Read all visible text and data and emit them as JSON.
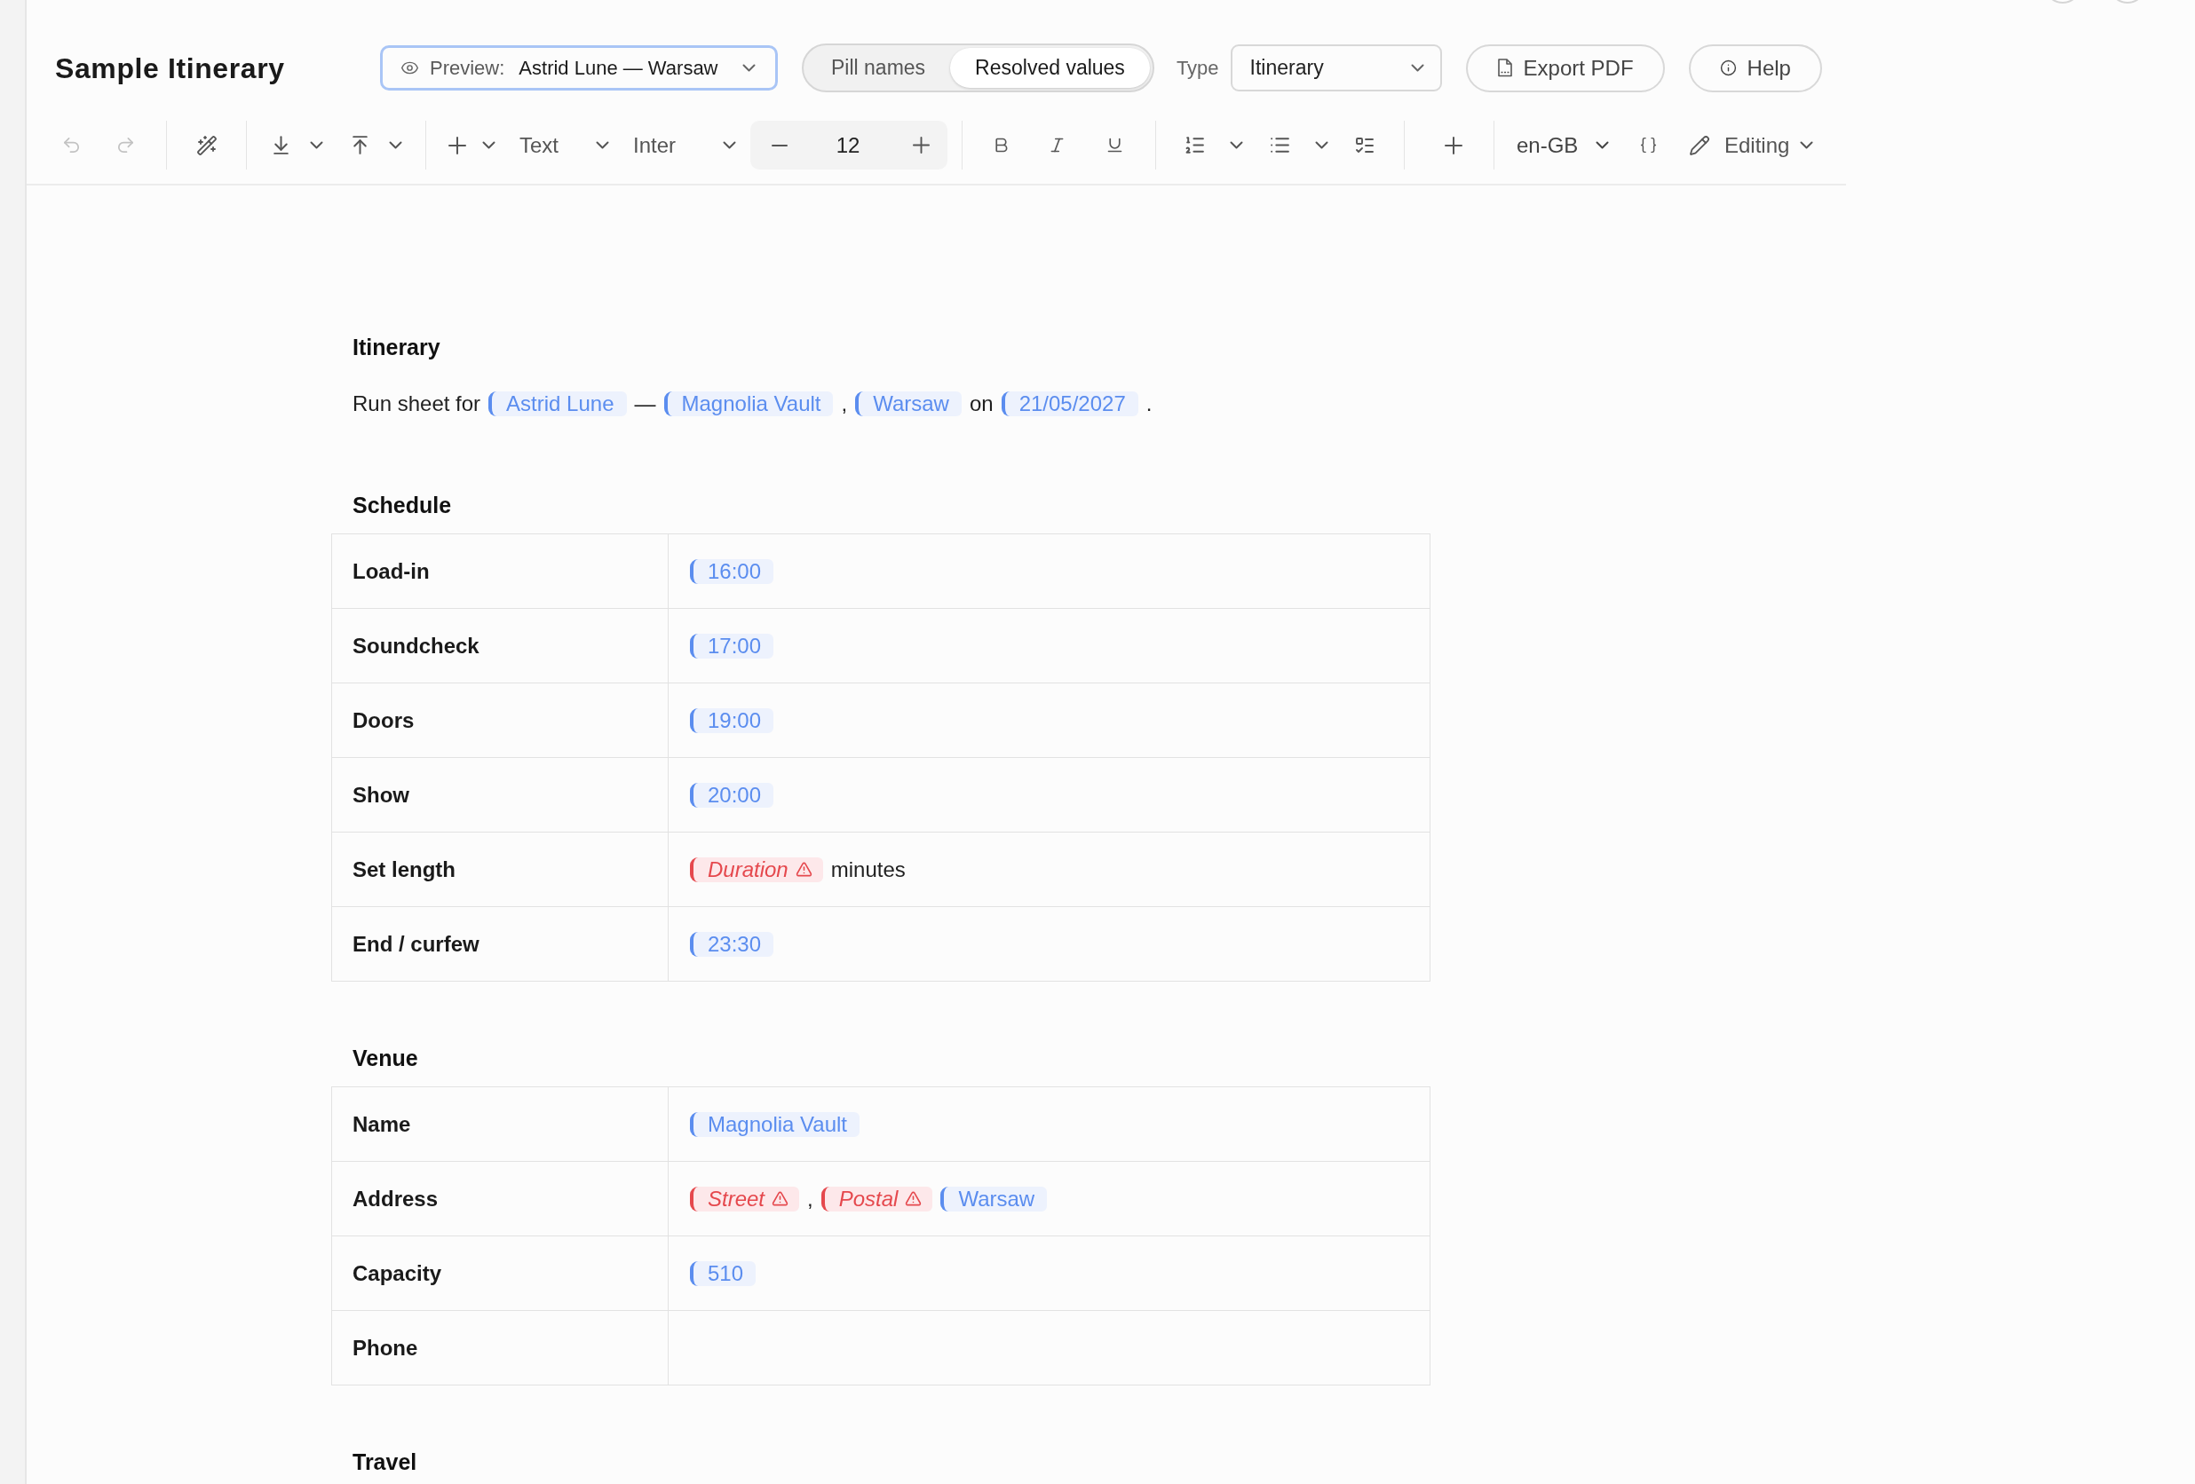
{
  "header": {
    "title": "Sample Itinerary",
    "preview": {
      "label": "Preview:",
      "value": "Astrid Lune — Warsaw"
    },
    "view_toggle": [
      {
        "label": "Pill names",
        "selected": false
      },
      {
        "label": "Resolved values",
        "selected": true
      }
    ],
    "type_select": {
      "label": "Type",
      "value": "Itinerary"
    },
    "buttons": [
      {
        "kind": "export",
        "label": "Export PDF"
      },
      {
        "kind": "help",
        "label": "Help"
      }
    ]
  },
  "toolbar": {
    "history": [
      {
        "kind": "undo",
        "disabled": true
      },
      {
        "kind": "redo",
        "disabled": true
      }
    ],
    "block_style": "Text",
    "font": "Inter",
    "font_size": "12",
    "language": "en-GB",
    "mode": "Editing"
  },
  "document": {
    "sections": [
      {
        "heading": "Itinerary",
        "paragraph": [
          {
            "kind": "text",
            "text": "Run sheet for"
          },
          {
            "kind": "variable",
            "text": "Astrid Lune"
          },
          {
            "kind": "text",
            "text": "—"
          },
          {
            "kind": "variable",
            "text": "Magnolia Vault"
          },
          {
            "kind": "text",
            "text": ","
          },
          {
            "kind": "variable",
            "text": "Warsaw"
          },
          {
            "kind": "text",
            "text": "on"
          },
          {
            "kind": "variable",
            "text": "21/05/2027"
          },
          {
            "kind": "text",
            "text": "."
          }
        ]
      },
      {
        "heading": "Schedule",
        "rows": [
          {
            "label": "Load-in",
            "value": [
              {
                "kind": "variable",
                "text": "16:00"
              }
            ]
          },
          {
            "label": "Soundcheck",
            "value": [
              {
                "kind": "variable",
                "text": "17:00"
              }
            ]
          },
          {
            "label": "Doors",
            "value": [
              {
                "kind": "variable",
                "text": "19:00"
              }
            ]
          },
          {
            "label": "Show",
            "value": [
              {
                "kind": "variable",
                "text": "20:00"
              }
            ]
          },
          {
            "label": "Set length",
            "value": [
              {
                "kind": "missing",
                "text": "Duration"
              },
              {
                "kind": "text",
                "text": "minutes"
              }
            ]
          },
          {
            "label": "End / curfew",
            "value": [
              {
                "kind": "variable",
                "text": "23:30"
              }
            ]
          }
        ]
      },
      {
        "heading": "Venue",
        "rows": [
          {
            "label": "Name",
            "value": [
              {
                "kind": "variable",
                "text": "Magnolia Vault"
              }
            ]
          },
          {
            "label": "Address",
            "value": [
              {
                "kind": "missing",
                "text": "Street"
              },
              {
                "kind": "text",
                "text": ","
              },
              {
                "kind": "missing",
                "text": "Postal"
              },
              {
                "kind": "variable",
                "text": "Warsaw"
              }
            ]
          },
          {
            "label": "Capacity",
            "value": [
              {
                "kind": "variable",
                "text": "510"
              }
            ]
          },
          {
            "label": "Phone"
          }
        ]
      },
      {
        "heading": "Travel"
      }
    ]
  }
}
